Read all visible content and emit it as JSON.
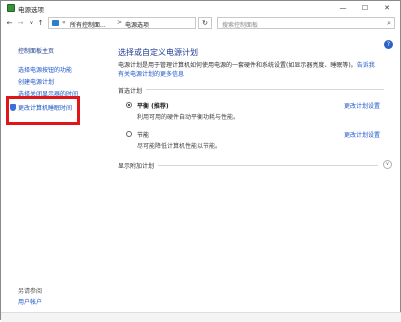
{
  "window": {
    "title": "电源选项"
  },
  "window_controls": {
    "minimize": "—",
    "maximize": "☐",
    "close": "✕"
  },
  "address": {
    "crumbs": [
      "所有控制面...",
      "电源选项"
    ],
    "separators": [
      "«",
      ">"
    ],
    "dropdown": "∨",
    "refresh": "↻"
  },
  "nav": {
    "back": "←",
    "forward": "→",
    "history": "∨",
    "up": "↑"
  },
  "search": {
    "placeholder": "搜索控制面板",
    "icon": "search-icon"
  },
  "sidebar": {
    "home": "控制面板主页",
    "items": [
      {
        "label": "选择电源按钮的功能"
      },
      {
        "label": "创建电源计划"
      },
      {
        "label": "选择关闭显示器的时间"
      },
      {
        "label": "更改计算机睡眠时间"
      }
    ],
    "see_also_title": "另请参阅",
    "see_also": [
      {
        "label": "用户帐户"
      }
    ]
  },
  "main": {
    "title": "选择或自定义电源计划",
    "description": "电源计划是用于管理计算机如何使用电源的一套硬件和系统设置(如显示器亮度、睡眠等)。",
    "description_link": "告诉我有关电源计划的更多信息",
    "preferred_label": "首选计划",
    "plans": [
      {
        "name": "平衡 (推荐)",
        "desc": "利用可用的硬件自动平衡功耗与性能。",
        "link": "更改计划设置",
        "selected": true
      },
      {
        "name": "节能",
        "desc": "尽可能降低计算机性能以节能。",
        "link": "更改计划设置",
        "selected": false
      }
    ],
    "extra_label": "显示附加计划",
    "expand_icon": "chevron-down-icon"
  },
  "colors": {
    "highlight": "#e0161b",
    "link": "#1a55c8",
    "title": "#1f3b94"
  }
}
